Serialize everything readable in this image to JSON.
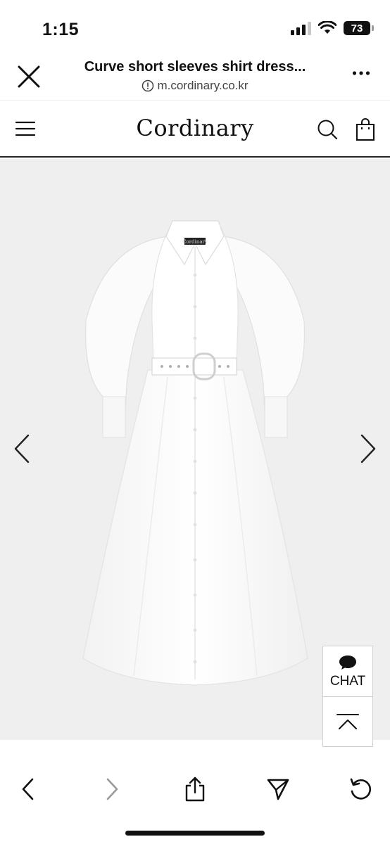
{
  "status_bar": {
    "time": "1:15",
    "battery_level": "73",
    "signal_bars_active": 3,
    "signal_bars_total": 4
  },
  "browser": {
    "page_title": "Curve short sleeves shirt dress...",
    "url": "m.cordinary.co.kr"
  },
  "site": {
    "logo_text": "Cordinary",
    "neck_tag_text": "Cordinary"
  },
  "gallery": {
    "image_subject": "white-shirt-dress-with-belt",
    "background_color": "#efefef"
  },
  "chat_widget": {
    "chat_label": "CHAT"
  },
  "colors": {
    "text": "#111111",
    "header_rule": "#222222",
    "gallery_bg": "#efefef",
    "disabled_icon": "#9a9a9a"
  }
}
